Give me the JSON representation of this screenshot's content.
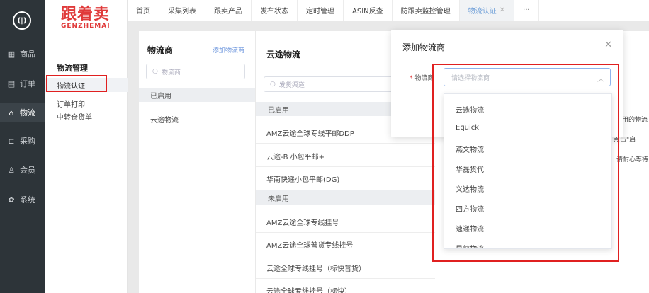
{
  "nav": {
    "items": [
      {
        "icon": "shop-icon",
        "glyph": "▦",
        "label": "商品"
      },
      {
        "icon": "order-icon",
        "glyph": "▤",
        "label": "订单"
      },
      {
        "icon": "logistics-icon",
        "glyph": "⌂",
        "label": "物流"
      },
      {
        "icon": "cart-icon",
        "glyph": "⊏",
        "label": "采购"
      },
      {
        "icon": "member-icon",
        "glyph": "♙",
        "label": "会员"
      },
      {
        "icon": "system-icon",
        "glyph": "✿",
        "label": "系统"
      }
    ]
  },
  "brand": {
    "cn": "跟着卖",
    "en": "GENZHEMAI"
  },
  "subnav": {
    "title": "物流管理",
    "items": [
      "物流认证",
      "订单打印",
      "中转仓货单"
    ]
  },
  "tabs": [
    "首页",
    "采集列表",
    "跟卖产品",
    "发布状态",
    "定时管理",
    "ASIN反查",
    "防跟卖监控管理",
    "物流认证",
    "···"
  ],
  "carriers": {
    "title": "物流商",
    "add_link": "添加物流商",
    "search_placeholder": "物流商",
    "enabled_label": "已启用",
    "items": [
      "云途物流"
    ]
  },
  "channels": {
    "title": "云途物流",
    "search_placeholder": "发货渠道",
    "enabled_label": "已启用",
    "enabled_items": [
      "AMZ云途全球专线平邮DDP",
      "云途-B 小包平邮+",
      "华南快递小包平邮(DG)"
    ],
    "disabled_label": "未启用",
    "disabled_items": [
      "AMZ云途全球专线挂号",
      "AMZ云途全球普货专线挂号",
      "云途全球专线挂号（标快普货）",
      "云途全球专线挂号（标快）"
    ]
  },
  "modal": {
    "title": "添加物流商",
    "field_label": "物流商",
    "select_placeholder": "请选择物流商"
  },
  "behind_fragments": [
    "用的物流",
    "点击\"启",
    "请耐心等待"
  ],
  "dropdown": {
    "options": [
      "云途物流",
      "Equick",
      "燕文物流",
      "华磊货代",
      "义达物流",
      "四方物流",
      "速递物流",
      "星前物流"
    ]
  },
  "colors": {
    "accent": "#6f9fd8",
    "highlight": "#e02020",
    "brand": "#e03a3a"
  }
}
